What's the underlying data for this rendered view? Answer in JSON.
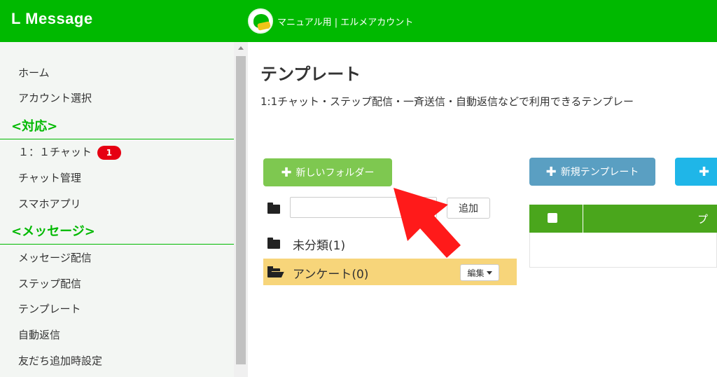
{
  "header": {
    "brand": "L Message",
    "account_name": "マニュアル用 | エルメアカウント"
  },
  "sidebar": {
    "items": [
      {
        "type": "item",
        "label": "ホーム"
      },
      {
        "type": "item",
        "label": "アカウント選択"
      },
      {
        "type": "section",
        "label": "<対応>"
      },
      {
        "type": "item",
        "label": "１：１チャット",
        "badge": "1"
      },
      {
        "type": "item",
        "label": "チャット管理"
      },
      {
        "type": "item",
        "label": "スマホアプリ"
      },
      {
        "type": "section",
        "label": "<メッセージ>"
      },
      {
        "type": "item",
        "label": "メッセージ配信"
      },
      {
        "type": "item",
        "label": "ステップ配信"
      },
      {
        "type": "item",
        "label": "テンプレート"
      },
      {
        "type": "item",
        "label": "自動返信"
      },
      {
        "type": "item",
        "label": "友だち追加時設定"
      }
    ]
  },
  "main": {
    "title": "テンプレート",
    "description": "1:1チャット・ステップ配信・一斉送信・自動返信などで利用できるテンプレー",
    "new_folder_label": "新しいフォルダー",
    "new_template_label": "新規テンプレート",
    "third_button_label": "",
    "folder_input_value": "",
    "add_label": "追加",
    "folders": [
      {
        "label": "未分類(1)"
      },
      {
        "label": "アンケート(0)",
        "edit_label": "編集"
      }
    ],
    "table_header_label": "プ"
  },
  "colors": {
    "brand_green": "#00b900",
    "folder_button": "#7ec850",
    "template_button": "#5a9fc2",
    "selected_folder": "#f7d57a",
    "table_header": "#4aa61c",
    "badge": "#e60012",
    "arrow": "#ff1a1a"
  }
}
